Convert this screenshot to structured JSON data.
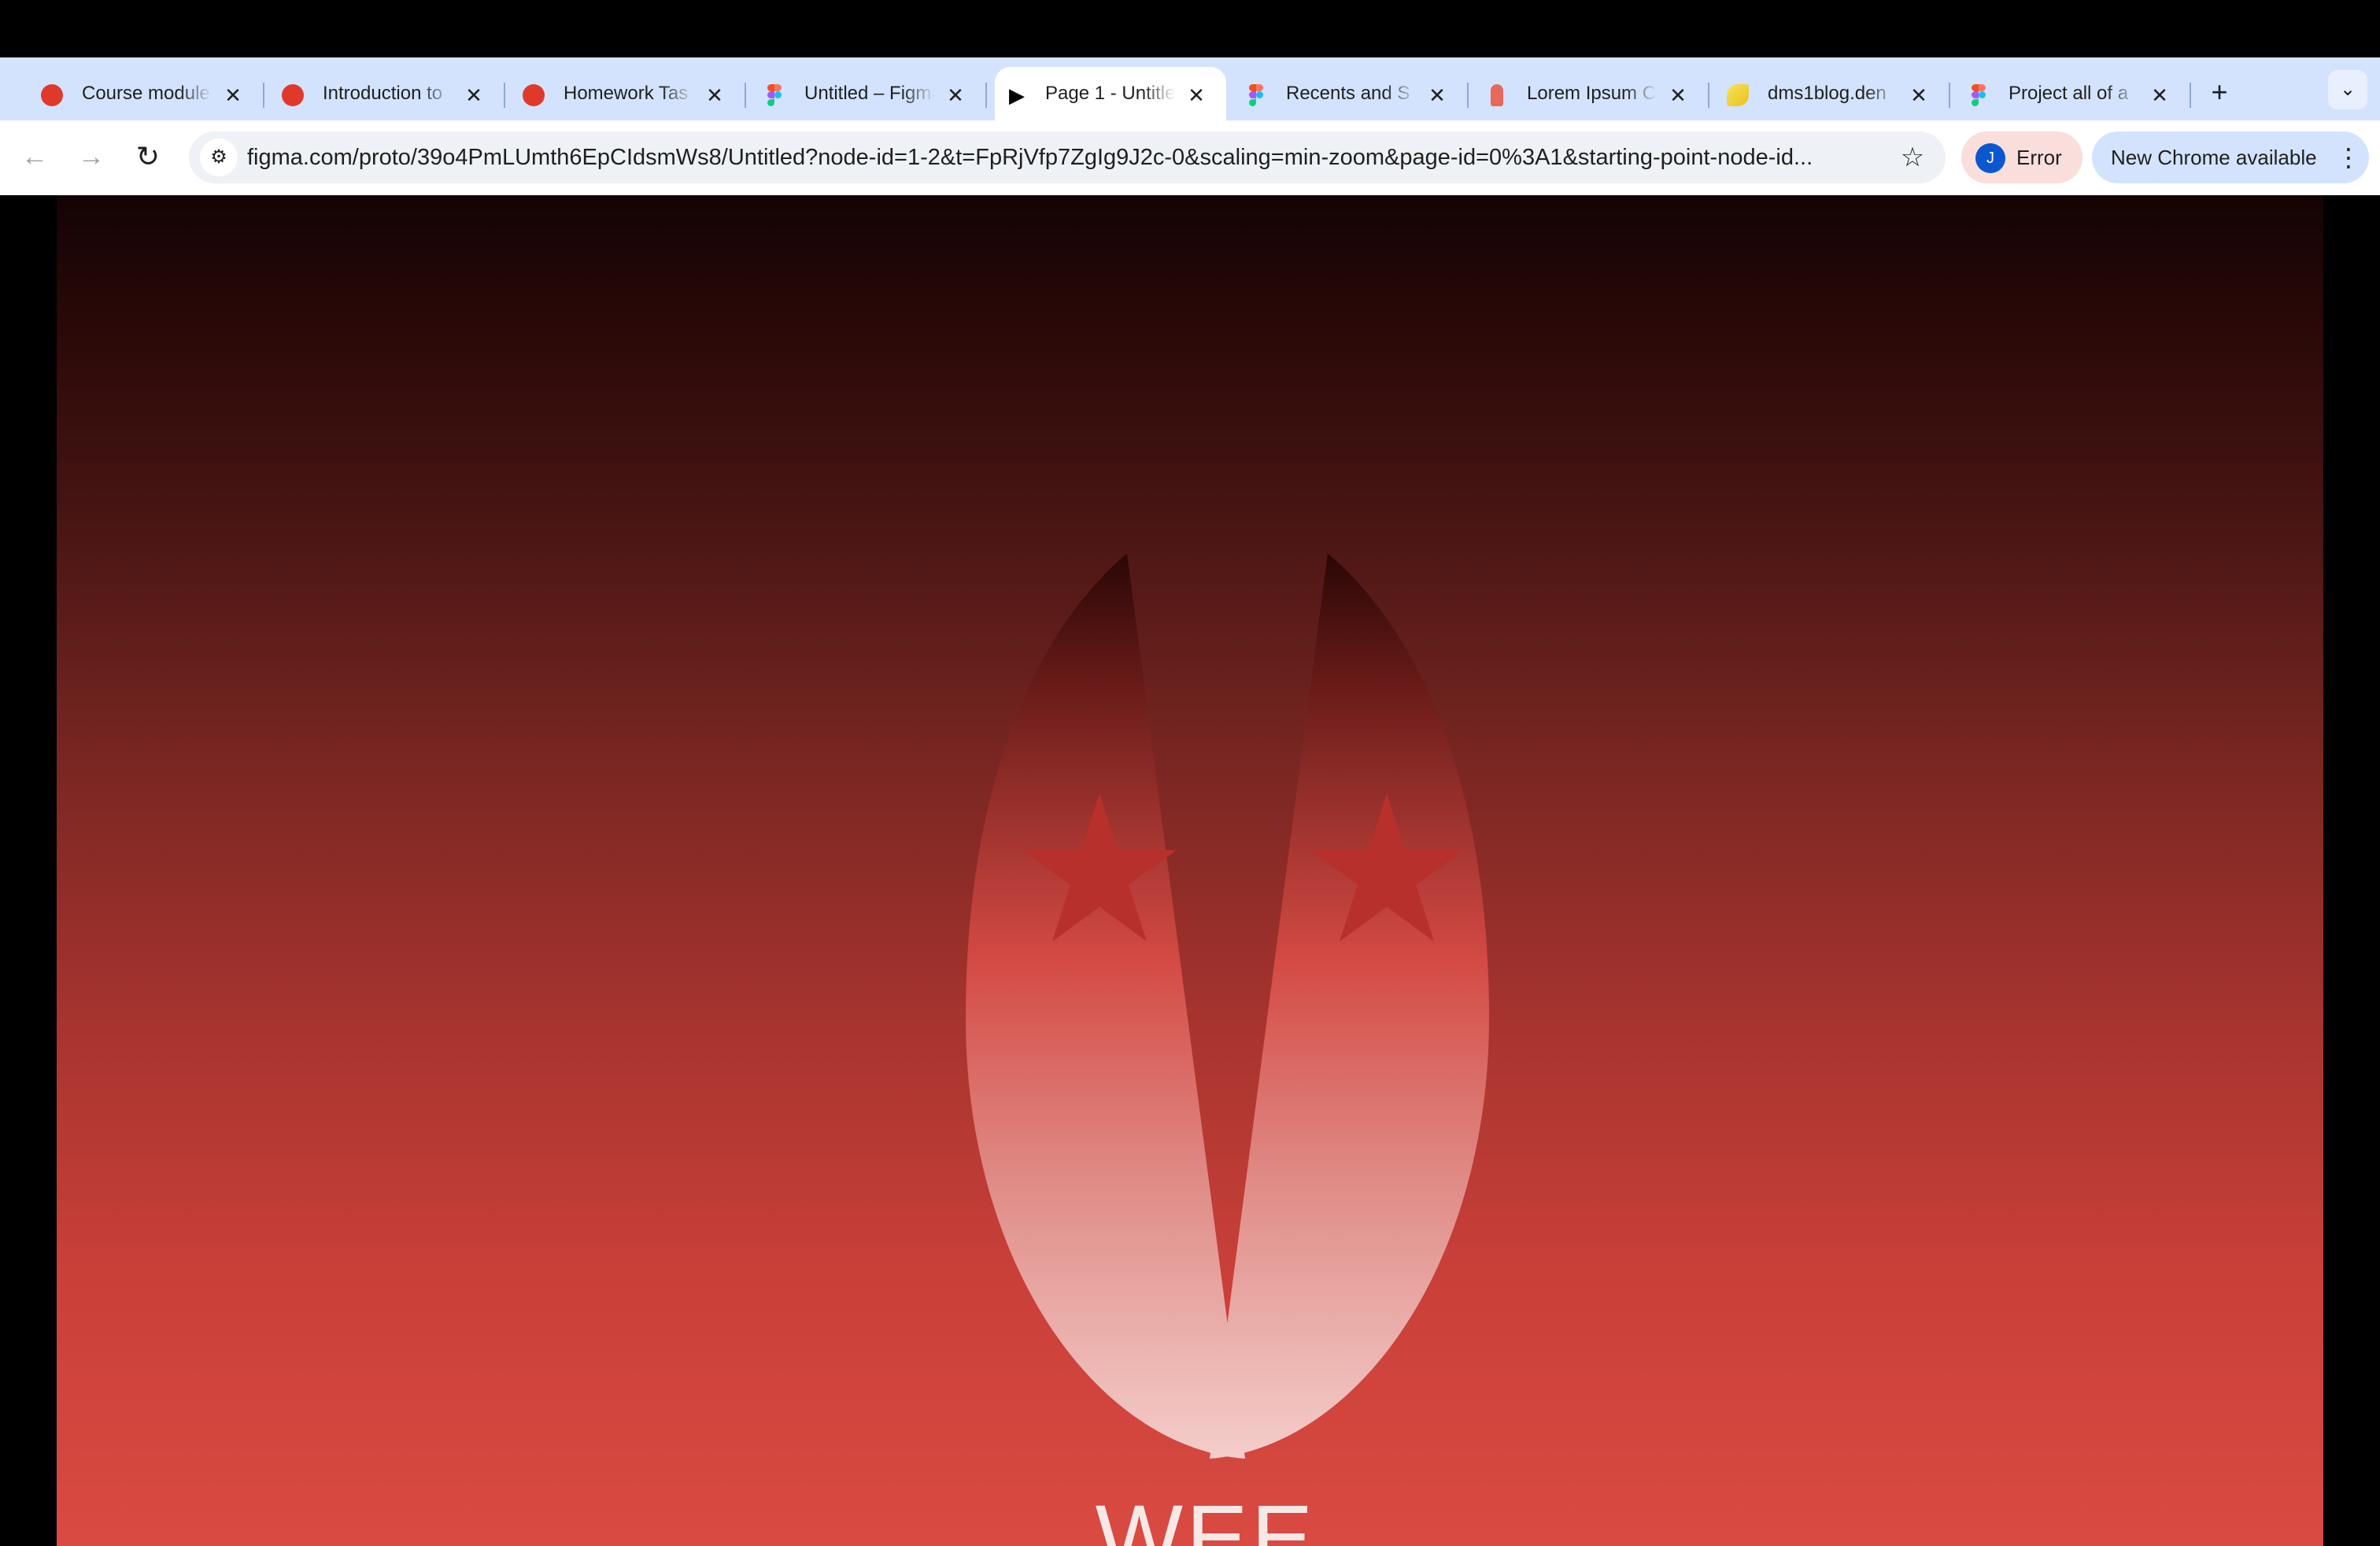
{
  "tabs": [
    {
      "title": "Course module",
      "favicon": "red-blob-icon",
      "active": false
    },
    {
      "title": "Introduction to",
      "favicon": "red-blob-icon",
      "active": false
    },
    {
      "title": "Homework Tas",
      "favicon": "red-blob-icon",
      "active": false
    },
    {
      "title": "Untitled – Figma",
      "favicon": "figma-icon",
      "active": false
    },
    {
      "title": "Page 1 - Untitled",
      "favicon": "play-icon",
      "active": true
    },
    {
      "title": "Recents and S",
      "favicon": "figma-icon",
      "active": false
    },
    {
      "title": "Lorem Ipsum C",
      "favicon": "red-person-icon",
      "active": false
    },
    {
      "title": "dms1blog.den",
      "favicon": "yellow-swirl-icon",
      "active": false
    },
    {
      "title": "Project all of a",
      "favicon": "figma-icon",
      "active": false
    }
  ],
  "toolbar": {
    "url": "figma.com/proto/39o4PmLUmth6EpCIdsmWs8/Untitled?node-id=1-2&t=FpRjVfp7ZgIg9J2c-0&scaling=min-zoom&page-id=0%3A1&starting-point-node-id...",
    "profile_initial": "J",
    "profile_status": "Error",
    "update_label": "New Chrome available"
  },
  "content": {
    "frame_title": "WEE WOO"
  },
  "colors": {
    "tabstrip": "#d3e3fd",
    "frame_top": "#140304",
    "frame_bottom": "#d94a42",
    "emblem_light": "#f2c9c6",
    "emblem_red": "#b8302c"
  }
}
